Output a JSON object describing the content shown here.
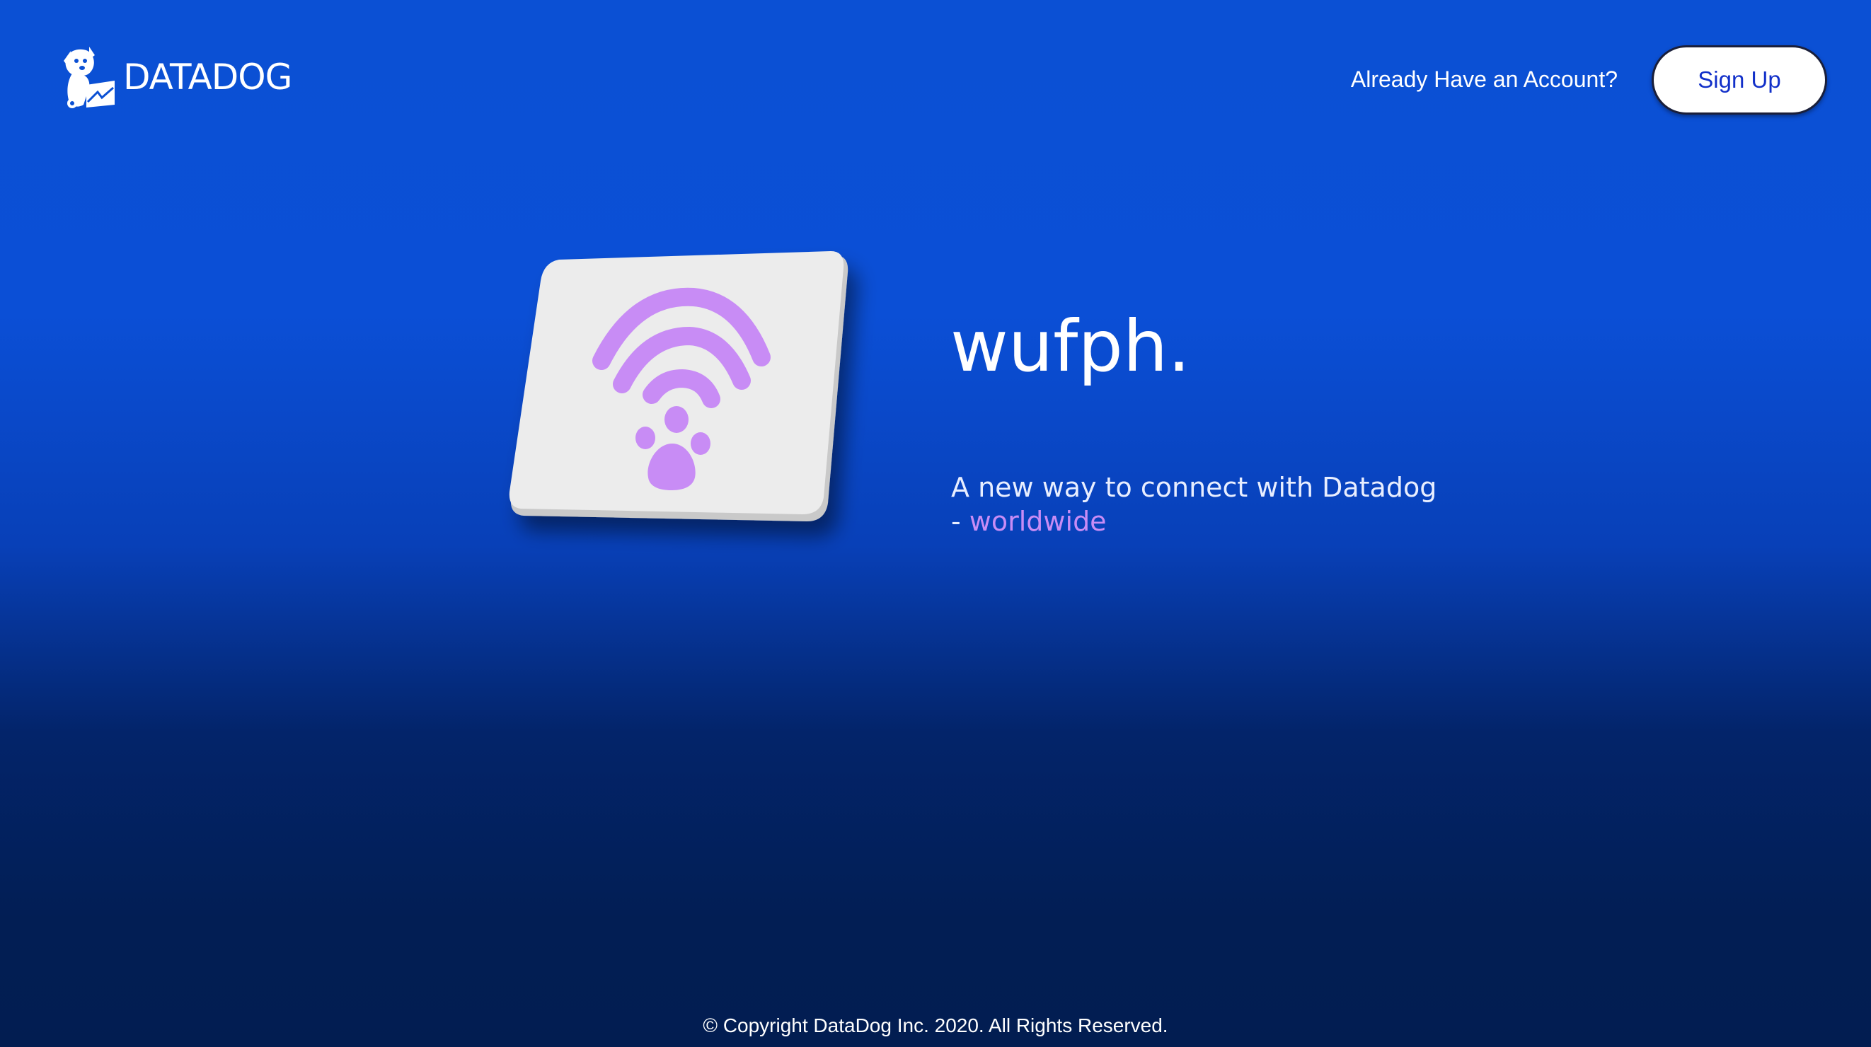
{
  "brand": {
    "name": "DATADOG",
    "logo_icon": "datadog-dog-icon"
  },
  "header": {
    "login_prompt": "Already Have an Account?",
    "signup_label": "Sign Up"
  },
  "hero": {
    "app_icon": "wifi-paw-icon",
    "title": "wufph.",
    "tagline_main": "A new way to connect with Datadog",
    "tagline_prefix": "- ",
    "tagline_accent": "worldwide"
  },
  "footer": {
    "copyright": "© Copyright DataDog Inc. 2020. All Rights Reserved."
  },
  "colors": {
    "background_top": "#0b50d4",
    "background_bottom": "#021d51",
    "accent_purple": "#c88cf5",
    "button_text": "#1230c9",
    "icon_tile": "#ececec"
  }
}
